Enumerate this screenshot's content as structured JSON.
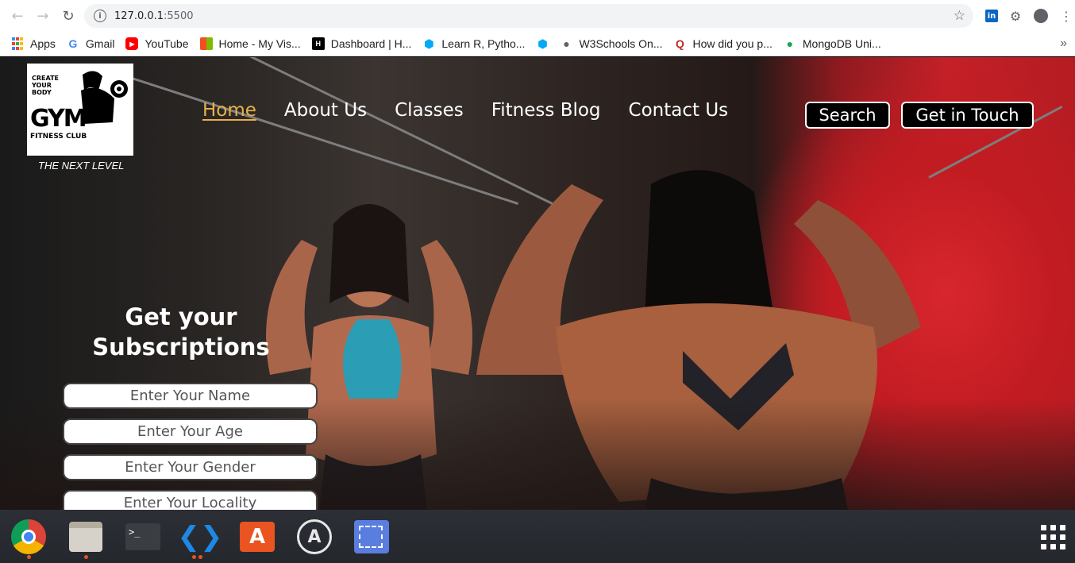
{
  "browser": {
    "url_host": "127.0.0.1",
    "url_port": ":5500",
    "bookmarks": [
      {
        "label": "Apps",
        "icon": "apps-grid-icon"
      },
      {
        "label": "Gmail",
        "icon": "google-icon",
        "color": "#4285f4"
      },
      {
        "label": "YouTube",
        "icon": "youtube-icon",
        "color": "#ff0000"
      },
      {
        "label": "Home - My Vis...",
        "icon": "microsoft-icon",
        "color": "#f25022"
      },
      {
        "label": "Dashboard | H...",
        "icon": "hackerrank-icon",
        "color": "#000000"
      },
      {
        "label": "Learn R, Pytho...",
        "icon": "datacamp-icon",
        "color": "#03a9f4"
      },
      {
        "label": "",
        "icon": "datacamp-icon",
        "color": "#03a9f4"
      },
      {
        "label": "W3Schools On...",
        "icon": "globe-icon",
        "color": "#5f6368"
      },
      {
        "label": "How did you p...",
        "icon": "quora-icon",
        "color": "#b92b27"
      },
      {
        "label": "MongoDB Uni...",
        "icon": "mongodb-icon",
        "color": "#13aa52"
      }
    ]
  },
  "site": {
    "logo": {
      "line1": "CREATE",
      "line2": "YOUR",
      "line3": "BODY",
      "gym": "GYM",
      "club": "FITNESS CLUB"
    },
    "tagline": "THE NEXT LEVEL",
    "nav": [
      {
        "label": "Home",
        "active": true
      },
      {
        "label": "About Us"
      },
      {
        "label": "Classes"
      },
      {
        "label": "Fitness Blog"
      },
      {
        "label": "Contact Us"
      }
    ],
    "search_label": "Search",
    "touch_label": "Get in Touch",
    "accent_color": "#e8b04b",
    "subscription": {
      "title_line1": "Get your",
      "title_line2": "Subscriptions",
      "fields": [
        {
          "placeholder": "Enter Your Name"
        },
        {
          "placeholder": "Enter Your Age"
        },
        {
          "placeholder": "Enter Your Gender"
        },
        {
          "placeholder": "Enter Your Locality"
        }
      ]
    }
  },
  "taskbar": {
    "apps": [
      "chrome-icon",
      "files-icon",
      "terminal-icon",
      "vscode-icon",
      "software-store-icon",
      "atom-icon",
      "screenshot-icon"
    ],
    "terminal_glyph": ">_",
    "store_glyph": "A",
    "atom_glyph": "A"
  }
}
